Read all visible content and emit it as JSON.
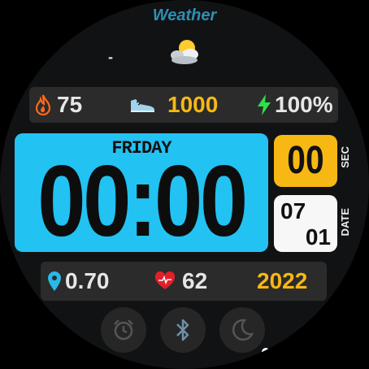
{
  "weather": {
    "title": "Weather",
    "temperature": "-",
    "icon": "partly-cloudy-icon"
  },
  "stats": {
    "calories": "75",
    "steps": "1000",
    "battery": "100%",
    "colors": {
      "calories": "#ff6a1a",
      "steps": "#f7b814",
      "battery": "#2ee04a"
    }
  },
  "time": {
    "day": "FRIDAY",
    "hours_minutes": "00:00",
    "seconds": "00",
    "seconds_label": "SEC",
    "date_month": "07",
    "date_day": "01",
    "date_label": "DATE"
  },
  "info": {
    "distance": "0.70",
    "heart_rate": "62",
    "year": "2022",
    "colors": {
      "distance_icon": "#29b8e8",
      "heart": "#e0202a",
      "year": "#f7b814"
    }
  },
  "buttons": [
    {
      "name": "alarm-button",
      "icon": "alarm-icon"
    },
    {
      "name": "bluetooth-button",
      "icon": "bluetooth-icon"
    },
    {
      "name": "do-not-disturb-button",
      "icon": "moon-icon"
    }
  ]
}
